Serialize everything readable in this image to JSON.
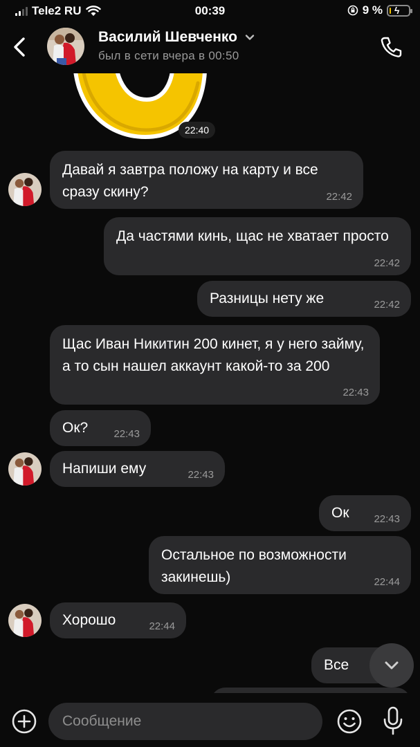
{
  "status_bar": {
    "carrier": "Tele2 RU",
    "time": "00:39",
    "battery": "9 %",
    "battery_level": 0.09
  },
  "header": {
    "name": "Василий Шевченко",
    "status": "был в сети вчера в 00:50"
  },
  "sticker": {
    "time": "22:40"
  },
  "messages": [
    {
      "side": "in",
      "avatar": true,
      "text": "Давай я завтра положу на карту и все сразу скину?",
      "time": "22:42"
    },
    {
      "side": "out",
      "text": "Да частями кинь, щас не хватает просто",
      "time": "22:42"
    },
    {
      "side": "out",
      "text": "Разницы нету же",
      "time": "22:42"
    },
    {
      "side": "in",
      "text": "Щас Иван Никитин 200 кинет, я у него займу, а то сын нашел аккаунт какой-то за 200",
      "time": "22:43"
    },
    {
      "side": "in",
      "text": "Ок?",
      "time": "22:43"
    },
    {
      "side": "in",
      "avatar": true,
      "text": "Напиши ему",
      "time": "22:43"
    },
    {
      "side": "out",
      "text": "Ок",
      "time": "22:43"
    },
    {
      "side": "out",
      "text": "Остальное по возможности закинешь)",
      "time": "22:44"
    },
    {
      "side": "in",
      "avatar": true,
      "text": "Хорошо",
      "time": "22:44"
    },
    {
      "side": "out",
      "text": "Все",
      "time": ""
    }
  ],
  "input": {
    "placeholder": "Сообщение"
  },
  "icons": {
    "back": "back-arrow-icon",
    "call": "phone-icon",
    "add": "plus-circle-icon",
    "emoji": "emoji-icon",
    "mic": "microphone-icon",
    "scroll": "chevron-down-icon"
  },
  "colors": {
    "background": "#0a0a0a",
    "bubble": "#2a2a2c",
    "secondary_text": "#9a9a9a",
    "sticker_yellow": "#f5c400"
  }
}
